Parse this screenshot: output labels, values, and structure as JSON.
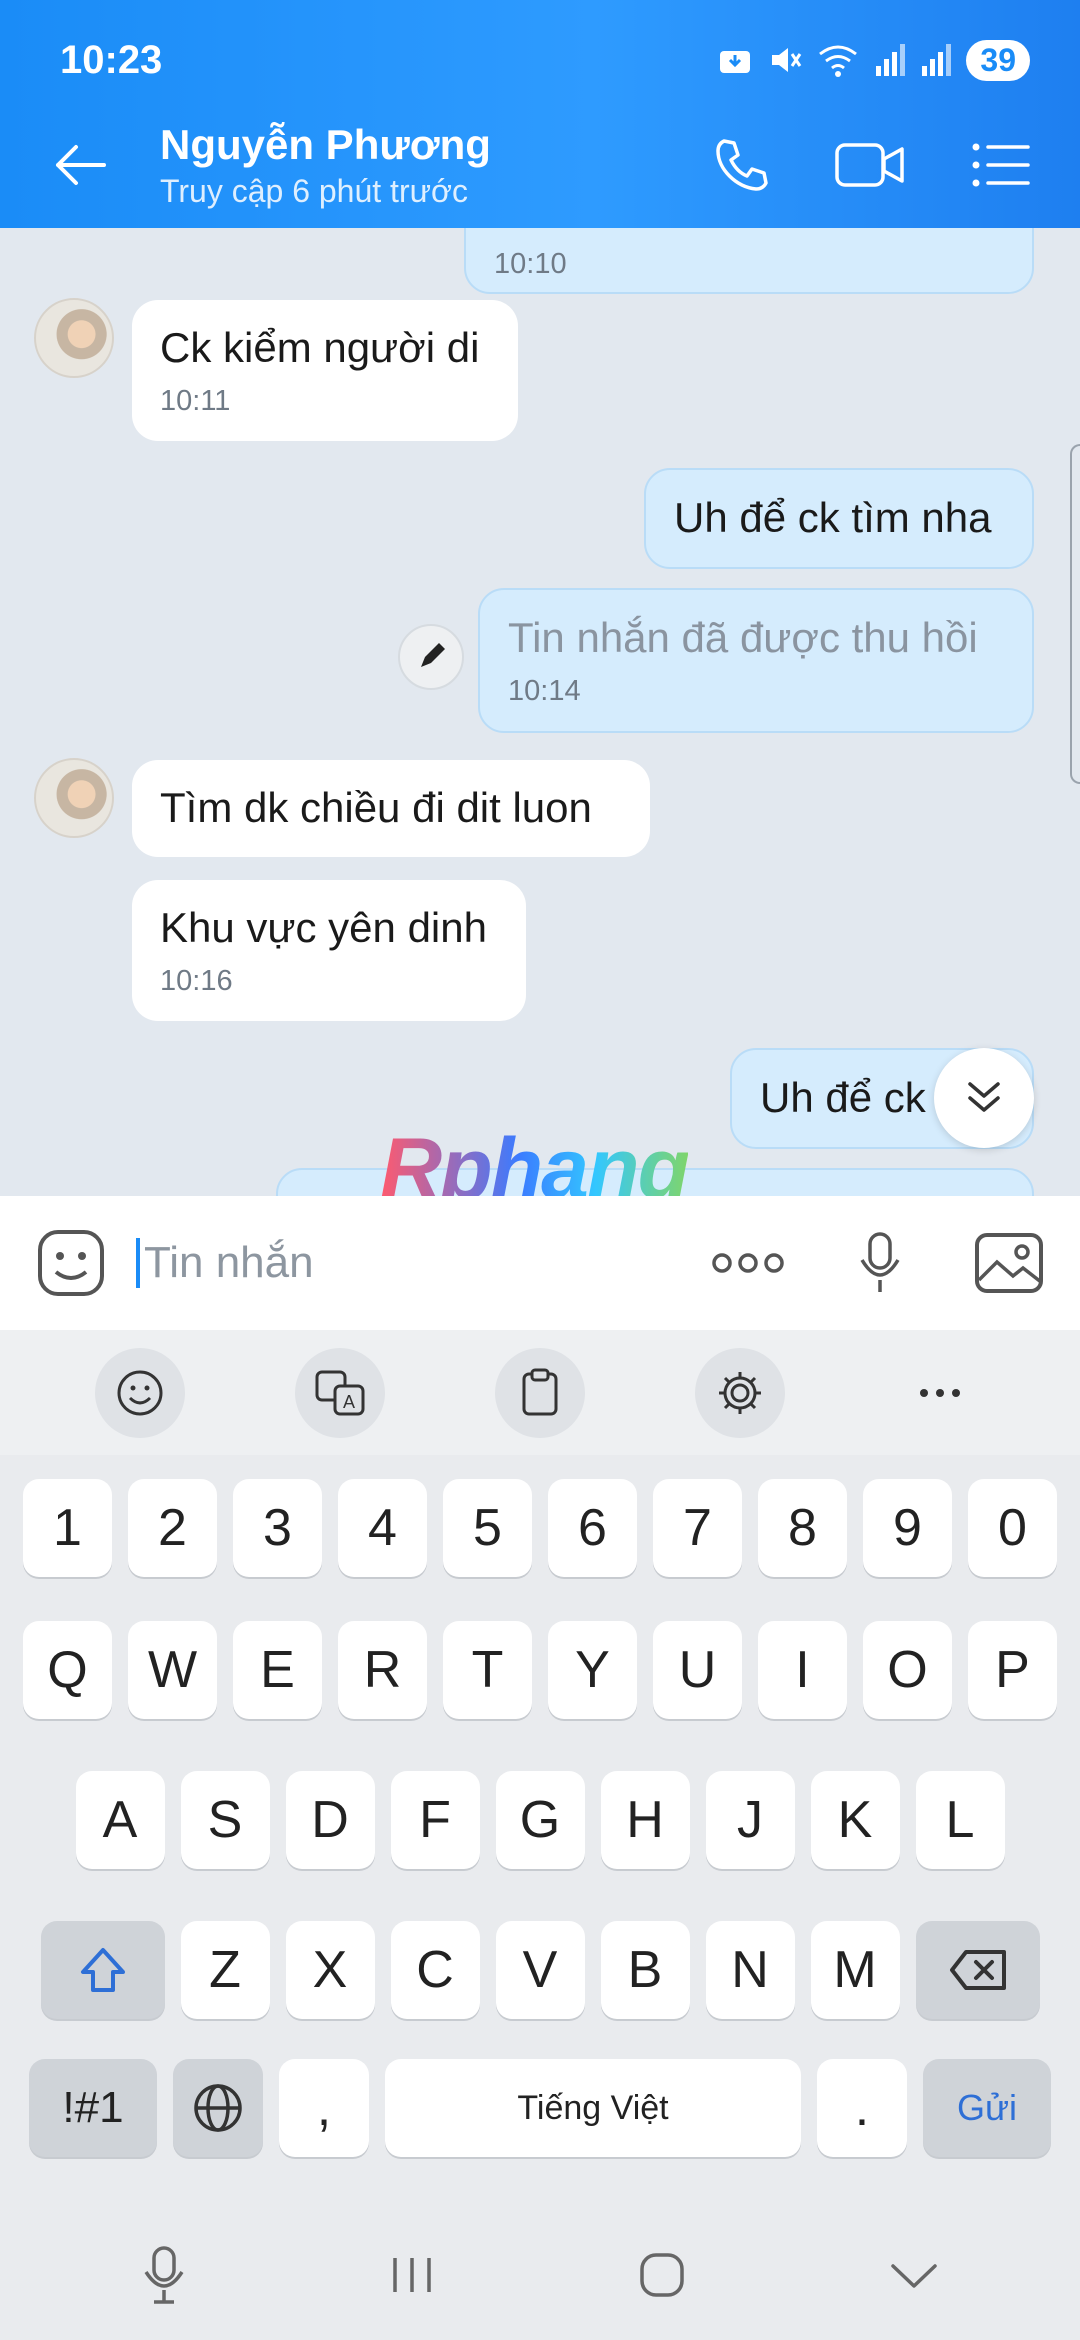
{
  "status_bar": {
    "time": "10:23",
    "battery": "39"
  },
  "header": {
    "contact_name": "Nguyễn Phương",
    "contact_status": "Truy cập 6 phút trước"
  },
  "messages": [
    {
      "time": "10:10"
    },
    {
      "text": "Ck kiểm người di",
      "time": "10:11"
    },
    {
      "text": "Uh để ck tìm nha"
    },
    {
      "text": "Tin nhắn đã được thu hồi",
      "time": "10:14"
    },
    {
      "text": "Tìm dk chiều đi dit luon"
    },
    {
      "text": "Khu vực yên dinh",
      "time": "10:16"
    },
    {
      "text": "Uh để ck"
    }
  ],
  "watermark": "Rphang",
  "input": {
    "placeholder": "Tin nhắn"
  },
  "keyboard": {
    "row_numbers": [
      "1",
      "2",
      "3",
      "4",
      "5",
      "6",
      "7",
      "8",
      "9",
      "0"
    ],
    "row1": [
      "Q",
      "W",
      "E",
      "R",
      "T",
      "Y",
      "U",
      "I",
      "O",
      "P"
    ],
    "row2": [
      "A",
      "S",
      "D",
      "F",
      "G",
      "H",
      "J",
      "K",
      "L"
    ],
    "row3": [
      "Z",
      "X",
      "C",
      "V",
      "B",
      "N",
      "M"
    ],
    "symbols": "!#1",
    "comma": ",",
    "space": "Tiếng Việt",
    "period": ".",
    "send": "Gửi"
  },
  "colors": {
    "header": "#1a8cf7",
    "outgoing_bubble": "#d5ecfd",
    "incoming_bubble": "#ffffff",
    "chat_bg": "#e2e8ef"
  }
}
